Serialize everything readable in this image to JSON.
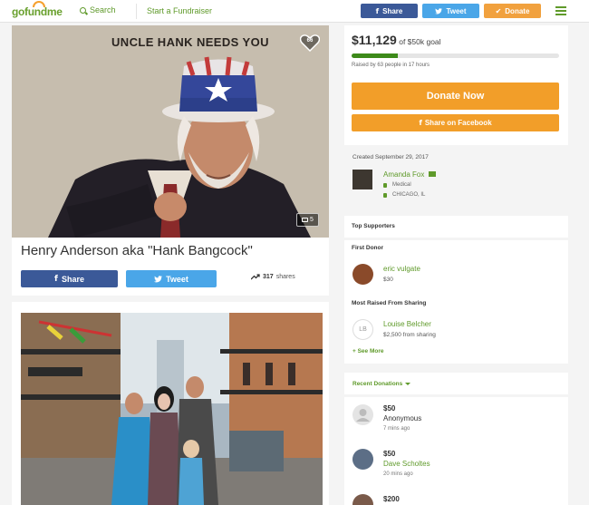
{
  "header": {
    "logo": "gofundme",
    "search_label": "Search",
    "start_label": "Start a Fundraiser",
    "share_label": "Share",
    "tweet_label": "Tweet",
    "donate_label": "Donate"
  },
  "campaign": {
    "hero_text": "UNCLE HANK NEEDS YOU",
    "hearts": "66",
    "photo_count": "5",
    "title": "Henry Anderson aka \"Hank Bangcock\"",
    "share_label": "Share",
    "tweet_label": "Tweet",
    "share_count": "317",
    "share_suffix": "shares"
  },
  "donation": {
    "raised": "$11,129",
    "goal": "of $50k goal",
    "progress": 0.223,
    "raised_by": "Raised by 63 people in 17 hours",
    "donate_now": "Donate Now",
    "share_facebook": "Share on Facebook"
  },
  "organizer": {
    "created": "Created September 29, 2017",
    "name": "Amanda Fox",
    "category": "Medical",
    "location": "CHICAGO, IL"
  },
  "supporters": {
    "heading": "Top Supporters",
    "first_donor_label": "First Donor",
    "first_donor": {
      "name": "eric vulgate",
      "amount": "$30"
    },
    "most_raised_label": "Most Raised From Sharing",
    "most_raised": {
      "initials": "LB",
      "name": "Louise Belcher",
      "amount": "$2,500 from sharing"
    },
    "see_more": "+ See More"
  },
  "recent": {
    "label": "Recent Donations",
    "items": [
      {
        "amount": "$50",
        "name": "Anonymous",
        "time": "7 mins ago"
      },
      {
        "amount": "$50",
        "name": "Dave Scholtes",
        "time": "20 mins ago"
      },
      {
        "amount": "$200",
        "name": "",
        "time": ""
      }
    ]
  },
  "colors": {
    "brand_green": "#5f9a2a",
    "donate_orange": "#f29e29",
    "facebook_blue": "#3b5998",
    "twitter_blue": "#4aa6e8"
  }
}
